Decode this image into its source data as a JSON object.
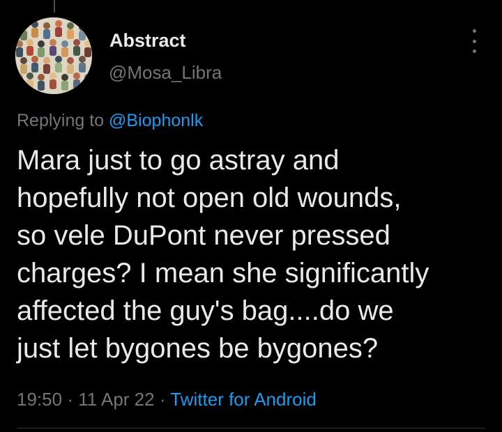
{
  "colors": {
    "background": "#000000",
    "primary_text": "#e7e9ea",
    "secondary_text": "#71767b",
    "link": "#1d9bf0",
    "divider": "#2f3336"
  },
  "author": {
    "display_name": "Abstract",
    "handle": "@Mosa_Libra",
    "avatar_icon": "crowd-illustration-avatar"
  },
  "menu": {
    "icon": "more-vertical-icon"
  },
  "reply": {
    "prefix": "Replying to",
    "mention": "@Biophonlk"
  },
  "tweet": {
    "lines": [
      "Mara just to go astray and",
      "hopefully not open old wounds,",
      "so vele DuPont never pressed",
      "charges? I mean she significantly",
      "affected the guy's bag....do we",
      "just let bygones be bygones?"
    ]
  },
  "meta": {
    "time": "19:50",
    "separator": "·",
    "date": "11 Apr 22",
    "source": "Twitter for Android"
  }
}
